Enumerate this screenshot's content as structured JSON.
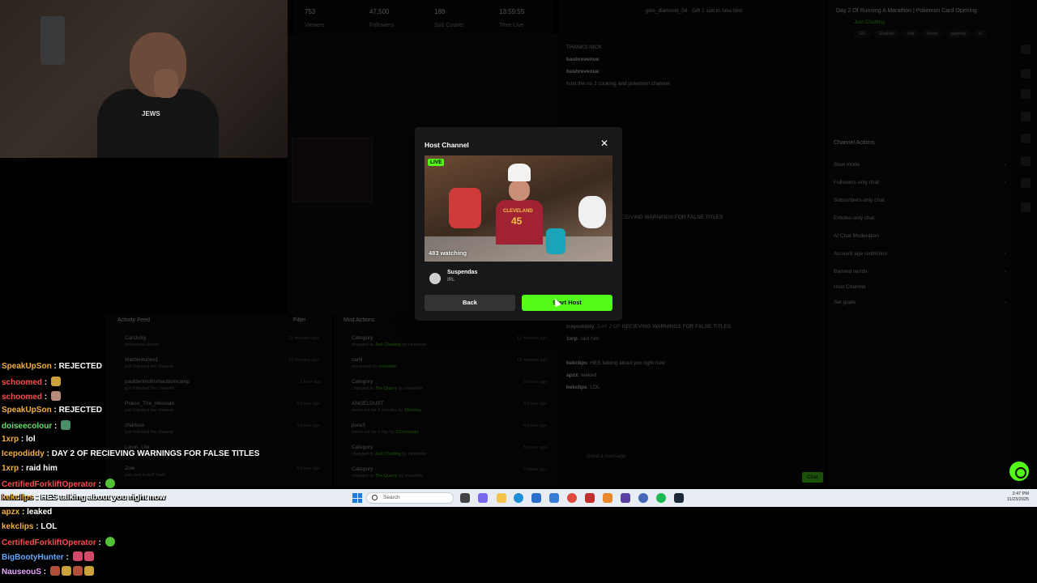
{
  "stats": [
    {
      "value": "753",
      "label": "Viewers"
    },
    {
      "value": "47,500",
      "label": "Followers"
    },
    {
      "value": "188",
      "label": "Sub Counts"
    },
    {
      "value": "13:59:55",
      "label": "Time Live"
    }
  ],
  "webcam": {
    "shirt_text": "JEWS"
  },
  "stream_info": {
    "title": "Day 2 Of Running A Marathon | Pokemon Card Opening",
    "category": "Just Chatting",
    "tags": [
      "18+",
      "English",
      "cnd",
      "funny",
      "gaming",
      "irl"
    ]
  },
  "channel_actions": {
    "header": "Channel Actions",
    "items": [
      "Slow mode",
      "Followers-only chat",
      "Subscribers-only chat",
      "Emotes-only chat",
      "AI Chat Moderation",
      "Account age restriction",
      "Banned words",
      "Host Channel",
      "Set goals"
    ]
  },
  "dashboard_chat": [
    {
      "user": "",
      "text": "give_diamond_04",
      "note": "Gift 1 sub to fake bird"
    },
    {
      "user": "",
      "text": "THANKS NICK"
    },
    {
      "user": "bashrevenue",
      "text": ""
    },
    {
      "user": "bashrevenue",
      "text": ""
    },
    {
      "user": "",
      "text": "host the no 2 cooking and pokemon channel"
    },
    {
      "user": "",
      "text": "RECEIVING WARNINGS FOR FALSE TITLES"
    },
    {
      "user": "Icepodiddy",
      "text": "DAY 2 OF RECIEVING WARNINGS FOR FALSE TITLES"
    },
    {
      "user": "1xrp",
      "text": "raid him"
    },
    {
      "user": "kekclips",
      "text": "HES talking about you right now"
    },
    {
      "user": "apzx",
      "text": "leaked"
    },
    {
      "user": "kekclips",
      "text": "LOL"
    }
  ],
  "chat_input": {
    "placeholder": "Send a message",
    "send_label": "Chat"
  },
  "activity_feed": {
    "title": "Activity Feed",
    "filter_label": "Filter",
    "items": [
      {
        "name": "CarlJung",
        "sub": "redeemed Unban",
        "time": "12 minutes ago"
      },
      {
        "name": "Marbledunes1",
        "sub": "just followed the channel",
        "time": "12 minutes ago"
      },
      {
        "name": "pauldeninofromautismcamp",
        "sub": "just followed the channel",
        "time": "1 hour ago"
      },
      {
        "name": "Praise_The_Messiah",
        "sub": "just followed the channel",
        "time": "3 hours ago"
      },
      {
        "name": "charless",
        "sub": "just followed the channel",
        "time": "3 hours ago"
      },
      {
        "name": "Loron_Ltw",
        "sub": "",
        "time": ""
      },
      {
        "name": "Zoie",
        "sub": "just sent a Hell Yeah",
        "time": "3 hours ago"
      }
    ]
  },
  "mod_actions": {
    "title": "Mod Actions",
    "items": [
      {
        "name": "Category",
        "sub_prefix": "changed to ",
        "sub_hl": "Just Chatting",
        "sub_suffix": " by nickwhite",
        "time": "12 minutes ago"
      },
      {
        "name": "carlil",
        "sub_prefix": "unbanned by ",
        "sub_hl": "nickwhite",
        "sub_suffix": "",
        "time": "12 minutes ago"
      },
      {
        "name": "Category",
        "sub_prefix": "changed to ",
        "sub_hl": "The Quarry",
        "sub_suffix": " by nickwhite",
        "time": "3 hours ago"
      },
      {
        "name": "ANGELDUST",
        "sub_prefix": "timed out for 3 minutes by ",
        "sub_hl": "Shmeley",
        "sub_suffix": "",
        "time": "4 hours ago"
      },
      {
        "name": "pure3",
        "sub_prefix": "timed out for 1 day by ",
        "sub_hl": "SSchwardo",
        "sub_suffix": "",
        "time": "4 hours ago"
      },
      {
        "name": "Category",
        "sub_prefix": "changed to ",
        "sub_hl": "Just Chatting",
        "sub_suffix": " by nickwhite",
        "time": "5 hours ago"
      },
      {
        "name": "Category",
        "sub_prefix": "changed to ",
        "sub_hl": "The Quarry",
        "sub_suffix": " by nickwhite",
        "time": "5 hours ago"
      }
    ]
  },
  "overlay_chat": [
    {
      "user": "SpeakUpSon",
      "color": "orange",
      "text": "REJECTED"
    },
    {
      "user": "schoomed",
      "color": "red",
      "text": ""
    },
    {
      "user": "schoomed",
      "color": "red",
      "text": ""
    },
    {
      "user": "SpeakUpSon",
      "color": "orange",
      "text": "REJECTED"
    },
    {
      "user": "doiseecolour",
      "color": "green",
      "text": ""
    },
    {
      "user": "1xrp",
      "color": "orange",
      "text": "lol"
    },
    {
      "user": "Icepodiddy",
      "color": "orange",
      "text": "DAY 2 OF RECIEVING WARNINGS FOR FALSE TITLES"
    },
    {
      "user": "1xrp",
      "color": "orange",
      "text": "raid him"
    },
    {
      "user": "CertifiedForkliftOperator",
      "color": "red",
      "text": ""
    },
    {
      "user": "kekclips",
      "color": "orange",
      "text": "HES talking about you right now"
    },
    {
      "user": "apzx",
      "color": "orange",
      "text": "leaked"
    },
    {
      "user": "kekclips",
      "color": "orange",
      "text": "LOL"
    },
    {
      "user": "CertifiedForkliftOperator",
      "color": "red",
      "text": ""
    },
    {
      "user": "BigBootyHunter",
      "color": "blue",
      "text": ""
    },
    {
      "user": "NauseouS",
      "color": "pink",
      "text": ""
    }
  ],
  "taskbar": {
    "search_placeholder": "Search",
    "time": "3:47 PM",
    "date": "11/23/2025"
  },
  "modal": {
    "title": "Host Channel",
    "live_label": "LIVE",
    "watching": "483 watching",
    "jersey_text": "CLEVELAND",
    "jersey_number": "45",
    "channel_name": "Suspendas",
    "channel_category": "IRL",
    "back_label": "Back",
    "start_label": "Start Host"
  }
}
